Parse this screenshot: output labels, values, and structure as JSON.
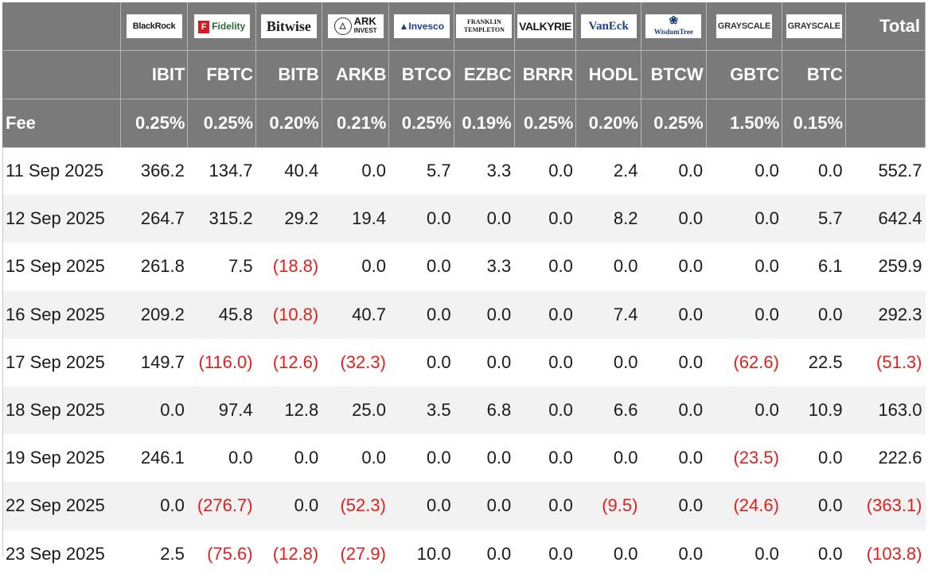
{
  "colors": {
    "header_bg": "#7a7a7a",
    "header_text": "#ffffff",
    "negative": "#e02020",
    "stripe": "#f2f2f2"
  },
  "logos": [
    {
      "key": "blackrock",
      "text": "BlackRock",
      "icon": "blackrock-logo"
    },
    {
      "key": "fidelity",
      "mark": "F",
      "text": "Fidelity",
      "icon": "fidelity-logo"
    },
    {
      "key": "bitwise",
      "text": "Bitwise",
      "icon": "bitwise-logo"
    },
    {
      "key": "ark",
      "line1": "ARK",
      "line2": "INVEST",
      "icon": "ark-invest-logo"
    },
    {
      "key": "invesco",
      "text": "Invesco",
      "icon": "invesco-logo"
    },
    {
      "key": "franklin",
      "line1": "FRANKLIN",
      "line2": "TEMPLETON",
      "icon": "franklin-templeton-logo"
    },
    {
      "key": "valkyrie",
      "text": "VALKYRIE",
      "icon": "valkyrie-logo"
    },
    {
      "key": "vaneck",
      "text": "VanEck",
      "icon": "vaneck-logo"
    },
    {
      "key": "wisdomtree",
      "text": "WisdomTree",
      "icon": "wisdomtree-logo"
    },
    {
      "key": "grayscale_gbtc",
      "text": "GRAYSCALE",
      "icon": "grayscale-logo"
    },
    {
      "key": "grayscale_btc",
      "text": "GRAYSCALE",
      "icon": "grayscale-logo"
    }
  ],
  "header": {
    "total_label": "Total",
    "tickers": [
      "IBIT",
      "FBTC",
      "BITB",
      "ARKB",
      "BTCO",
      "EZBC",
      "BRRR",
      "HODL",
      "BTCW",
      "GBTC",
      "BTC"
    ],
    "fee_label": "Fee",
    "fees": [
      "0.25%",
      "0.25%",
      "0.20%",
      "0.21%",
      "0.25%",
      "0.19%",
      "0.25%",
      "0.20%",
      "0.25%",
      "1.50%",
      "0.15%"
    ]
  },
  "rows": [
    {
      "date": "11 Sep 2025",
      "values": [
        "366.2",
        "134.7",
        "40.4",
        "0.0",
        "5.7",
        "3.3",
        "0.0",
        "2.4",
        "0.0",
        "0.0",
        "0.0"
      ],
      "total": "552.7"
    },
    {
      "date": "12 Sep 2025",
      "values": [
        "264.7",
        "315.2",
        "29.2",
        "19.4",
        "0.0",
        "0.0",
        "0.0",
        "8.2",
        "0.0",
        "0.0",
        "5.7"
      ],
      "total": "642.4"
    },
    {
      "date": "15 Sep 2025",
      "values": [
        "261.8",
        "7.5",
        "(18.8)",
        "0.0",
        "0.0",
        "3.3",
        "0.0",
        "0.0",
        "0.0",
        "0.0",
        "6.1"
      ],
      "total": "259.9"
    },
    {
      "date": "16 Sep 2025",
      "values": [
        "209.2",
        "45.8",
        "(10.8)",
        "40.7",
        "0.0",
        "0.0",
        "0.0",
        "7.4",
        "0.0",
        "0.0",
        "0.0"
      ],
      "total": "292.3"
    },
    {
      "date": "17 Sep 2025",
      "values": [
        "149.7",
        "(116.0)",
        "(12.6)",
        "(32.3)",
        "0.0",
        "0.0",
        "0.0",
        "0.0",
        "0.0",
        "(62.6)",
        "22.5"
      ],
      "total": "(51.3)"
    },
    {
      "date": "18 Sep 2025",
      "values": [
        "0.0",
        "97.4",
        "12.8",
        "25.0",
        "3.5",
        "6.8",
        "0.0",
        "6.6",
        "0.0",
        "0.0",
        "10.9"
      ],
      "total": "163.0"
    },
    {
      "date": "19 Sep 2025",
      "values": [
        "246.1",
        "0.0",
        "0.0",
        "0.0",
        "0.0",
        "0.0",
        "0.0",
        "0.0",
        "0.0",
        "(23.5)",
        "0.0"
      ],
      "total": "222.6"
    },
    {
      "date": "22 Sep 2025",
      "values": [
        "0.0",
        "(276.7)",
        "0.0",
        "(52.3)",
        "0.0",
        "0.0",
        "0.0",
        "(9.5)",
        "0.0",
        "(24.6)",
        "0.0"
      ],
      "total": "(363.1)"
    },
    {
      "date": "23 Sep 2025",
      "values": [
        "2.5",
        "(75.6)",
        "(12.8)",
        "(27.9)",
        "10.0",
        "0.0",
        "0.0",
        "0.0",
        "0.0",
        "0.0",
        "0.0"
      ],
      "total": "(103.8)"
    }
  ]
}
